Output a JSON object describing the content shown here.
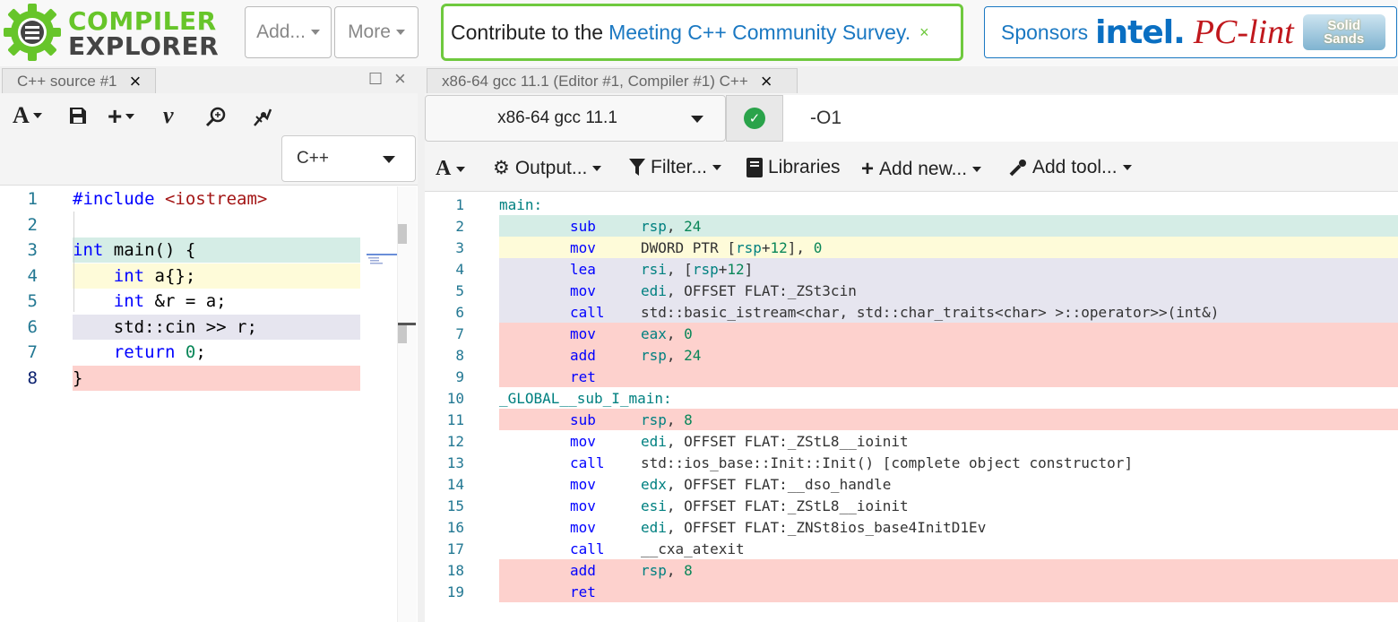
{
  "brand": {
    "line1": "COMPILER",
    "line2": "EXPLORER"
  },
  "nav": {
    "add_label": "Add...",
    "more_label": "More",
    "survey_lead": "Contribute to the",
    "survey_link": "Meeting C++ Community Survey.",
    "survey_close": "×",
    "sponsors_label": "Sponsors",
    "sponsor_intel": "intel.",
    "sponsor_pclint": "PC-lint",
    "sponsor_solid_1": "Solid",
    "sponsor_solid_2": "Sands"
  },
  "source_pane": {
    "tab_label": "C++ source #1",
    "language": "C++",
    "lines": [
      {
        "n": "1",
        "text": "#include <iostream>",
        "hl": ""
      },
      {
        "n": "2",
        "text": "",
        "hl": ""
      },
      {
        "n": "3",
        "text": "int main() {",
        "hl": "#d5ede6"
      },
      {
        "n": "4",
        "text": "    int a{};",
        "hl": "#fefbd9"
      },
      {
        "n": "5",
        "text": "    int &r = a;",
        "hl": ""
      },
      {
        "n": "6",
        "text": "    std::cin >> r;",
        "hl": "#e6e5ef"
      },
      {
        "n": "7",
        "text": "    return 0;",
        "hl": ""
      },
      {
        "n": "8",
        "text": "}",
        "hl": "#fdd1cd"
      }
    ]
  },
  "compiler_pane": {
    "tab_label": "x86-64 gcc 11.1 (Editor #1, Compiler #1) C++",
    "compiler": "x86-64 gcc 11.1",
    "options": "-O1",
    "toolbar": {
      "output": "Output...",
      "filter": "Filter...",
      "libraries": "Libraries",
      "add_new": "Add new...",
      "add_tool": "Add tool..."
    },
    "asm": [
      {
        "n": "1",
        "label": "main:",
        "op": "",
        "args": "",
        "hl": ""
      },
      {
        "n": "2",
        "label": "",
        "op": "sub",
        "args": "rsp, 24",
        "hl": "#d5ede6"
      },
      {
        "n": "3",
        "label": "",
        "op": "mov",
        "args": "DWORD PTR [rsp+12], 0",
        "hl": "#fefbd9"
      },
      {
        "n": "4",
        "label": "",
        "op": "lea",
        "args": "rsi, [rsp+12]",
        "hl": "#e6e5ef"
      },
      {
        "n": "5",
        "label": "",
        "op": "mov",
        "args": "edi, OFFSET FLAT:_ZSt3cin",
        "hl": "#e6e5ef"
      },
      {
        "n": "6",
        "label": "",
        "op": "call",
        "args": "std::basic_istream<char, std::char_traits<char> >::operator>>(int&)",
        "hl": "#e6e5ef"
      },
      {
        "n": "7",
        "label": "",
        "op": "mov",
        "args": "eax, 0",
        "hl": "#fdd1cd"
      },
      {
        "n": "8",
        "label": "",
        "op": "add",
        "args": "rsp, 24",
        "hl": "#fdd1cd"
      },
      {
        "n": "9",
        "label": "",
        "op": "ret",
        "args": "",
        "hl": "#fdd1cd"
      },
      {
        "n": "10",
        "label": "_GLOBAL__sub_I_main:",
        "op": "",
        "args": "",
        "hl": ""
      },
      {
        "n": "11",
        "label": "",
        "op": "sub",
        "args": "rsp, 8",
        "hl": "#fdd1cd"
      },
      {
        "n": "12",
        "label": "",
        "op": "mov",
        "args": "edi, OFFSET FLAT:_ZStL8__ioinit",
        "hl": ""
      },
      {
        "n": "13",
        "label": "",
        "op": "call",
        "args": "std::ios_base::Init::Init() [complete object constructor]",
        "hl": ""
      },
      {
        "n": "14",
        "label": "",
        "op": "mov",
        "args": "edx, OFFSET FLAT:__dso_handle",
        "hl": ""
      },
      {
        "n": "15",
        "label": "",
        "op": "mov",
        "args": "esi, OFFSET FLAT:_ZStL8__ioinit",
        "hl": ""
      },
      {
        "n": "16",
        "label": "",
        "op": "mov",
        "args": "edi, OFFSET FLAT:_ZNSt8ios_base4InitD1Ev",
        "hl": ""
      },
      {
        "n": "17",
        "label": "",
        "op": "call",
        "args": "__cxa_atexit",
        "hl": ""
      },
      {
        "n": "18",
        "label": "",
        "op": "add",
        "args": "rsp, 8",
        "hl": "#fdd1cd"
      },
      {
        "n": "19",
        "label": "",
        "op": "ret",
        "args": "",
        "hl": "#fdd1cd"
      }
    ]
  },
  "colors": {
    "brand_green": "#67c52a",
    "link_blue": "#1a78c2",
    "success": "#2aa34a"
  }
}
